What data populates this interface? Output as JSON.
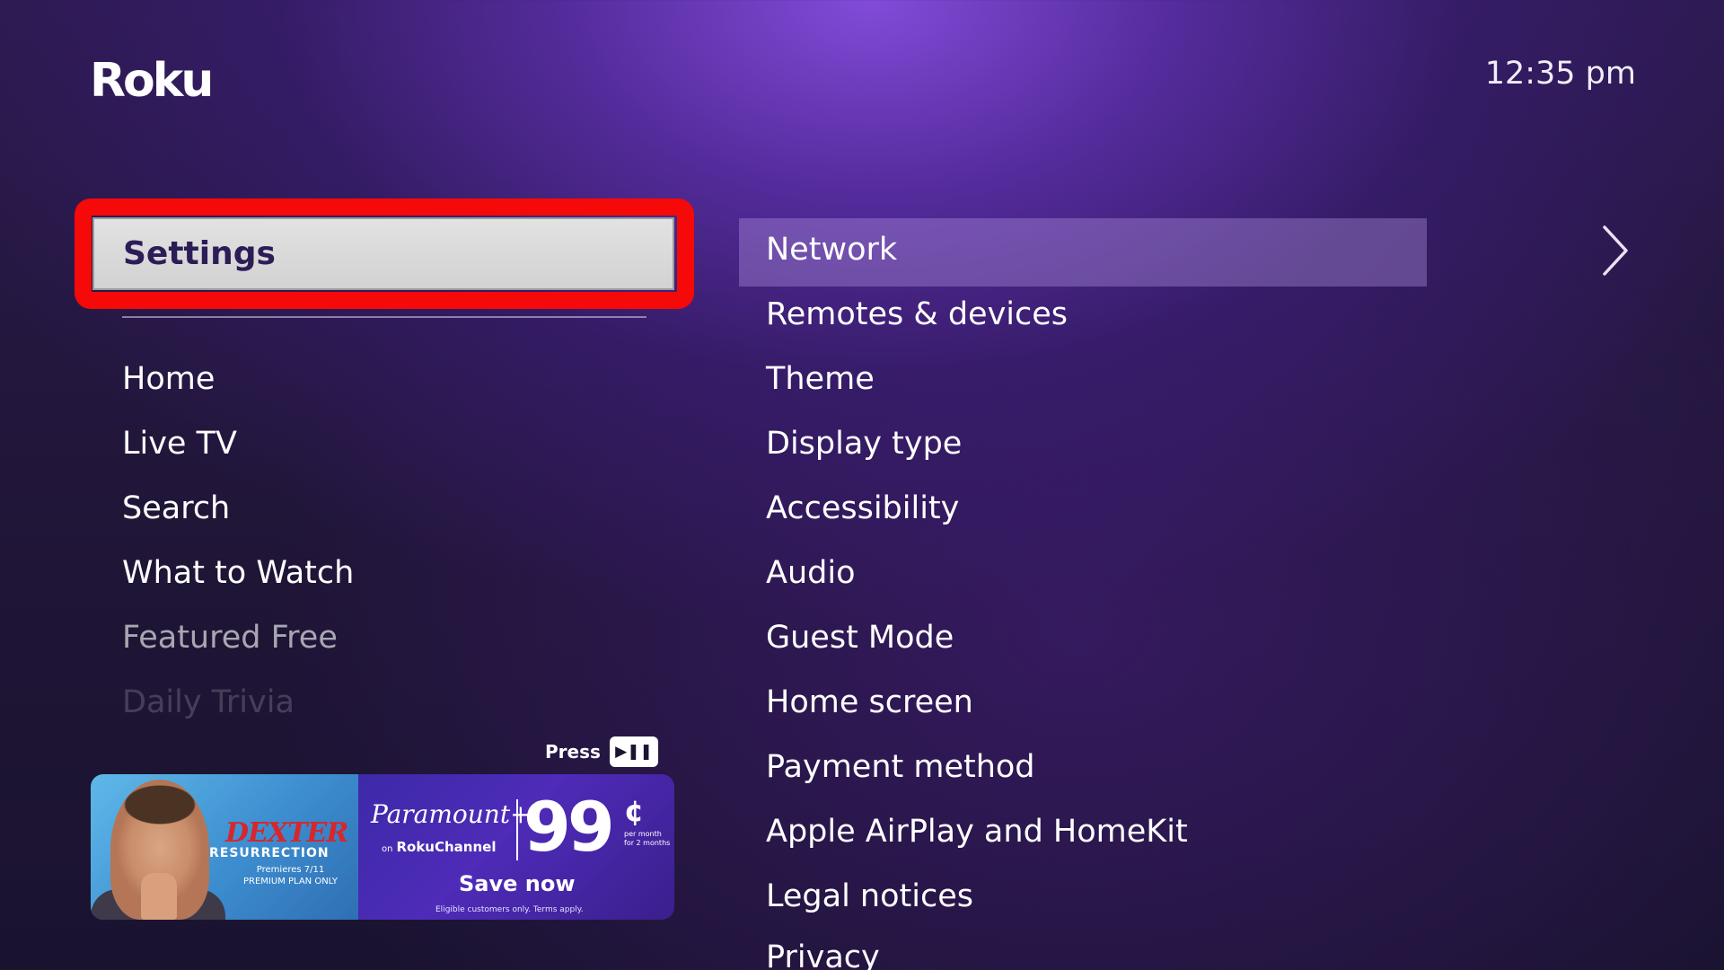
{
  "header": {
    "logo": "Roku",
    "clock": "12:35 pm"
  },
  "left_menu": {
    "selected": "Settings",
    "items": [
      {
        "label": "Home"
      },
      {
        "label": "Live TV"
      },
      {
        "label": "Search"
      },
      {
        "label": "What to Watch"
      },
      {
        "label": "Featured Free"
      },
      {
        "label": "Daily Trivia"
      }
    ]
  },
  "ad": {
    "press_label": "Press",
    "key_icon": "play-pause-icon",
    "key_glyph": "▶❚❚",
    "left": {
      "title": "DEXTER",
      "subtitle": "RESURRECTION",
      "premieres": "Premieres 7/11",
      "plan": "PREMIUM PLAN ONLY"
    },
    "right": {
      "brand": "Paramount+",
      "on": "on",
      "channel": "RokuChannel",
      "price": "99",
      "cents": "¢",
      "per_month": "per month",
      "for_months": "for 2 months",
      "cta": "Save now",
      "fine_print": "Eligible customers only. Terms apply."
    }
  },
  "settings_menu": {
    "items": [
      {
        "label": "Network"
      },
      {
        "label": "Remotes & devices"
      },
      {
        "label": "Theme"
      },
      {
        "label": "Display type"
      },
      {
        "label": "Accessibility"
      },
      {
        "label": "Audio"
      },
      {
        "label": "Guest Mode"
      },
      {
        "label": "Home screen"
      },
      {
        "label": "Payment method"
      },
      {
        "label": "Apple AirPlay and HomeKit"
      },
      {
        "label": "Legal notices"
      },
      {
        "label": "Privacy"
      }
    ]
  },
  "colors": {
    "highlight_border": "#f50909",
    "selected_text": "#2d1d56",
    "accent_purple": "#6c3fc7"
  }
}
